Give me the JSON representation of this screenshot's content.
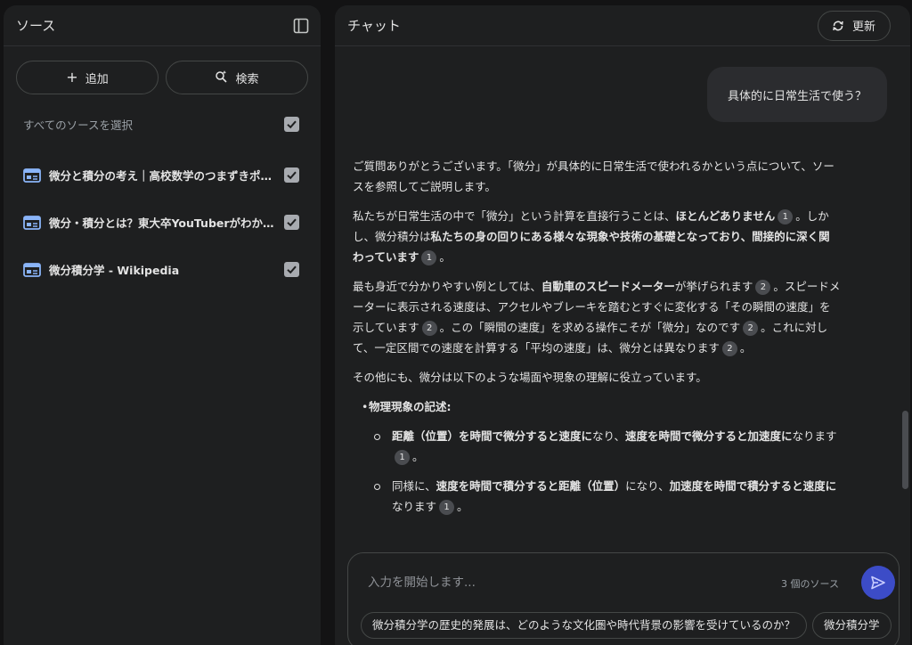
{
  "sources_panel": {
    "title": "ソース",
    "add_label": "追加",
    "search_label": "検索",
    "select_all_label": "すべてのソースを選択",
    "items": [
      {
        "title": "微分と積分の考え｜高校数学のつまずきポイント"
      },
      {
        "title": "微分・積分とは？東大卒YouTuberがわかりやすく解説"
      },
      {
        "title": "微分積分学 - Wikipedia"
      }
    ]
  },
  "chat_panel": {
    "title": "チャット",
    "refresh_label": "更新",
    "user_message": "具体的に日常生活で使う？",
    "response": {
      "p1": "ご質問ありがとうございます。「微分」が具体的に日常生活で使われるかという点について、ソースを参照してご説明します。",
      "p2a": "私たちが日常生活の中で「微分」という計算を直接行うことは、",
      "p2b": "ほとんどありません",
      "p2c": "。しかし、微分積分は",
      "p2d": "私たちの身の回りにある様々な現象や技術の基礎となっており、間接的に深く関わっています",
      "p2e": "。",
      "p3a": "最も身近で分かりやすい例としては、",
      "p3b": "自動車のスピードメーター",
      "p3c": "が挙げられます",
      "p3d": "。スピードメーターに表示される速度は、アクセルやブレーキを踏むとすぐに変化する「その瞬間の速度」を示しています",
      "p3e": "。この「瞬間の速度」を求める操作こそが「微分」なのです",
      "p3f": "。これに対して、一定区間での速度を計算する「平均の速度」は、微分とは異なります",
      "p3g": "。",
      "p4": "その他にも、微分は以下のような場面や現象の理解に役立っています。",
      "bullet1": "物理現象の記述:",
      "sub1a": "距離（位置）を時間で微分すると速度に",
      "sub1b": "なり、",
      "sub1c": "速度を時間で微分すると加速度に",
      "sub1d": "なります",
      "sub1e": "。",
      "sub2a": "同様に、",
      "sub2b": "速度を時間で積分すると距離（位置）",
      "sub2c": "になり、",
      "sub2d": "加速度を時間で積分すると速度に",
      "sub2e": "なります",
      "sub2f": "。",
      "cite1": "1",
      "cite2": "2"
    },
    "input": {
      "placeholder": "入力を開始します...",
      "source_count": "3 個のソース"
    },
    "suggestions": [
      "微分積分学の歴史的発展は、どのような文化圏や時代背景の影響を受けているのか？",
      "微分積分学"
    ]
  }
}
